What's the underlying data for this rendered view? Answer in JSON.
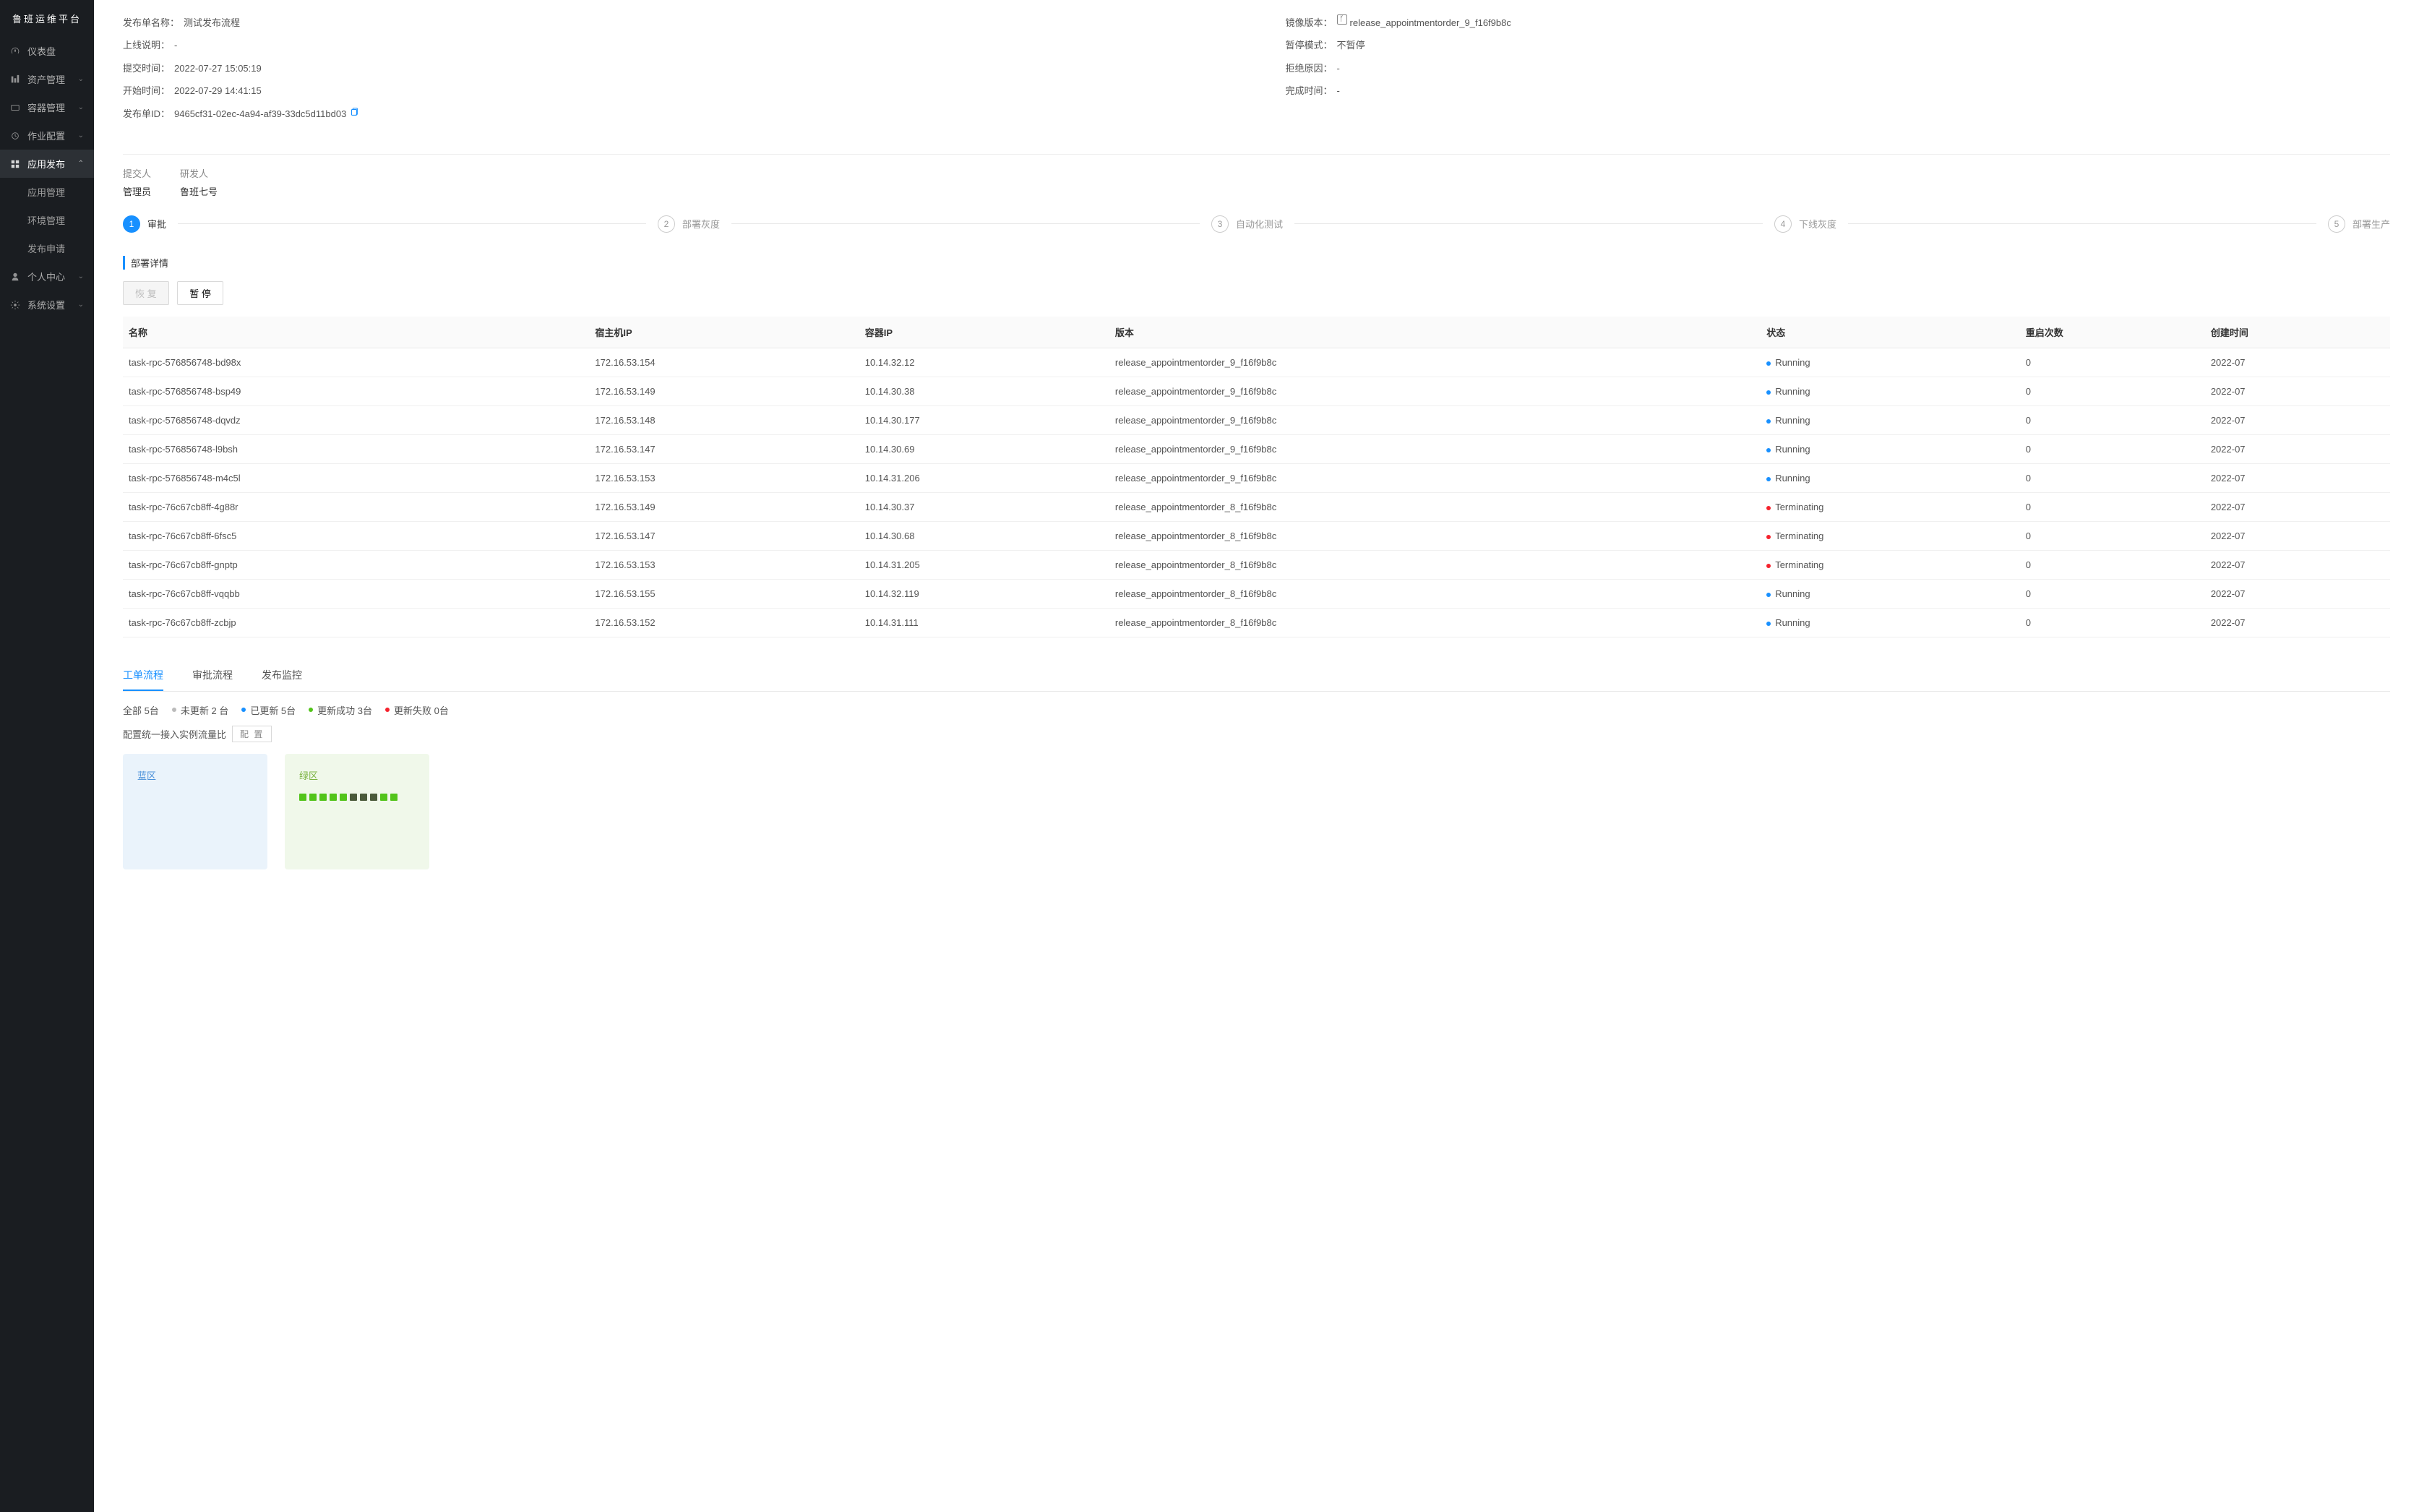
{
  "sidebar": {
    "logo": "鲁班运维平台",
    "items": [
      {
        "label": "仪表盘",
        "icon": "dashboard"
      },
      {
        "label": "资产管理",
        "icon": "bars",
        "expandable": true
      },
      {
        "label": "容器管理",
        "icon": "container",
        "expandable": true
      },
      {
        "label": "作业配置",
        "icon": "job",
        "expandable": true
      },
      {
        "label": "应用发布",
        "icon": "app",
        "expandable": true,
        "active": true
      },
      {
        "label": "个人中心",
        "icon": "user",
        "expandable": true
      },
      {
        "label": "系统设置",
        "icon": "settings",
        "expandable": true
      }
    ],
    "submenu": [
      {
        "label": "应用管理"
      },
      {
        "label": "环境管理"
      },
      {
        "label": "发布申请"
      }
    ]
  },
  "info": {
    "left": {
      "release_name_label": "发布单名称：",
      "release_name_value": "测试发布流程",
      "online_desc_label": "上线说明：",
      "online_desc_value": "-",
      "submit_time_label": "提交时间：",
      "submit_time_value": "2022-07-27 15:05:19",
      "start_time_label": "开始时间：",
      "start_time_value": "2022-07-29 14:41:15",
      "release_id_label": "发布单ID：",
      "release_id_value": "9465cf31-02ec-4a94-af39-33dc5d11bd03"
    },
    "right": {
      "image_version_label": "镜像版本：",
      "image_version_value": "release_appointmentorder_9_f16f9b8c",
      "pause_mode_label": "暂停模式：",
      "pause_mode_value": "不暂停",
      "reject_reason_label": "拒绝原因：",
      "reject_reason_value": "-",
      "complete_time_label": "完成时间：",
      "complete_time_value": "-"
    }
  },
  "people": {
    "submitter_label": "提交人",
    "submitter_value": "管理员",
    "developer_label": "研发人",
    "developer_value": "鲁班七号"
  },
  "steps": [
    {
      "num": "1",
      "label": "审批",
      "active": true
    },
    {
      "num": "2",
      "label": "部署灰度"
    },
    {
      "num": "3",
      "label": "自动化测试"
    },
    {
      "num": "4",
      "label": "下线灰度"
    },
    {
      "num": "5",
      "label": "部署生产"
    }
  ],
  "section_title": "部署详情",
  "buttons": {
    "resume": "恢 复",
    "pause": "暂 停"
  },
  "table": {
    "headers": {
      "name": "名称",
      "host_ip": "宿主机IP",
      "container_ip": "容器IP",
      "version": "版本",
      "status": "状态",
      "restarts": "重启次数",
      "created": "创建时间"
    },
    "rows": [
      {
        "name": "task-rpc-576856748-bd98x",
        "host_ip": "172.16.53.154",
        "container_ip": "10.14.32.12",
        "version": "release_appointmentorder_9_f16f9b8c",
        "status": "Running",
        "status_kind": "running",
        "restarts": "0",
        "created": "2022-07"
      },
      {
        "name": "task-rpc-576856748-bsp49",
        "host_ip": "172.16.53.149",
        "container_ip": "10.14.30.38",
        "version": "release_appointmentorder_9_f16f9b8c",
        "status": "Running",
        "status_kind": "running",
        "restarts": "0",
        "created": "2022-07"
      },
      {
        "name": "task-rpc-576856748-dqvdz",
        "host_ip": "172.16.53.148",
        "container_ip": "10.14.30.177",
        "version": "release_appointmentorder_9_f16f9b8c",
        "status": "Running",
        "status_kind": "running",
        "restarts": "0",
        "created": "2022-07"
      },
      {
        "name": "task-rpc-576856748-l9bsh",
        "host_ip": "172.16.53.147",
        "container_ip": "10.14.30.69",
        "version": "release_appointmentorder_9_f16f9b8c",
        "status": "Running",
        "status_kind": "running",
        "restarts": "0",
        "created": "2022-07"
      },
      {
        "name": "task-rpc-576856748-m4c5l",
        "host_ip": "172.16.53.153",
        "container_ip": "10.14.31.206",
        "version": "release_appointmentorder_9_f16f9b8c",
        "status": "Running",
        "status_kind": "running",
        "restarts": "0",
        "created": "2022-07"
      },
      {
        "name": "task-rpc-76c67cb8ff-4g88r",
        "host_ip": "172.16.53.149",
        "container_ip": "10.14.30.37",
        "version": "release_appointmentorder_8_f16f9b8c",
        "status": "Terminating",
        "status_kind": "terminating",
        "restarts": "0",
        "created": "2022-07"
      },
      {
        "name": "task-rpc-76c67cb8ff-6fsc5",
        "host_ip": "172.16.53.147",
        "container_ip": "10.14.30.68",
        "version": "release_appointmentorder_8_f16f9b8c",
        "status": "Terminating",
        "status_kind": "terminating",
        "restarts": "0",
        "created": "2022-07"
      },
      {
        "name": "task-rpc-76c67cb8ff-gnptp",
        "host_ip": "172.16.53.153",
        "container_ip": "10.14.31.205",
        "version": "release_appointmentorder_8_f16f9b8c",
        "status": "Terminating",
        "status_kind": "terminating",
        "restarts": "0",
        "created": "2022-07"
      },
      {
        "name": "task-rpc-76c67cb8ff-vqqbb",
        "host_ip": "172.16.53.155",
        "container_ip": "10.14.32.119",
        "version": "release_appointmentorder_8_f16f9b8c",
        "status": "Running",
        "status_kind": "running",
        "restarts": "0",
        "created": "2022-07"
      },
      {
        "name": "task-rpc-76c67cb8ff-zcbjp",
        "host_ip": "172.16.53.152",
        "container_ip": "10.14.31.111",
        "version": "release_appointmentorder_8_f16f9b8c",
        "status": "Running",
        "status_kind": "running",
        "restarts": "0",
        "created": "2022-07"
      }
    ]
  },
  "tabs": [
    {
      "label": "工单流程",
      "active": true
    },
    {
      "label": "审批流程"
    },
    {
      "label": "发布监控"
    }
  ],
  "stats": {
    "total": "全部 5台",
    "not_updated": "未更新 2 台",
    "updated": "已更新 5台",
    "success": "更新成功 3台",
    "failed": "更新失败 0台"
  },
  "config": {
    "label": "配置统一接入实例流量比",
    "chip": "配 置"
  },
  "zones": {
    "blue_title": "蓝区",
    "green_title": "绿区",
    "green_dots": [
      "g",
      "g",
      "g",
      "g",
      "g",
      "d",
      "d",
      "d",
      "g",
      "g"
    ]
  }
}
